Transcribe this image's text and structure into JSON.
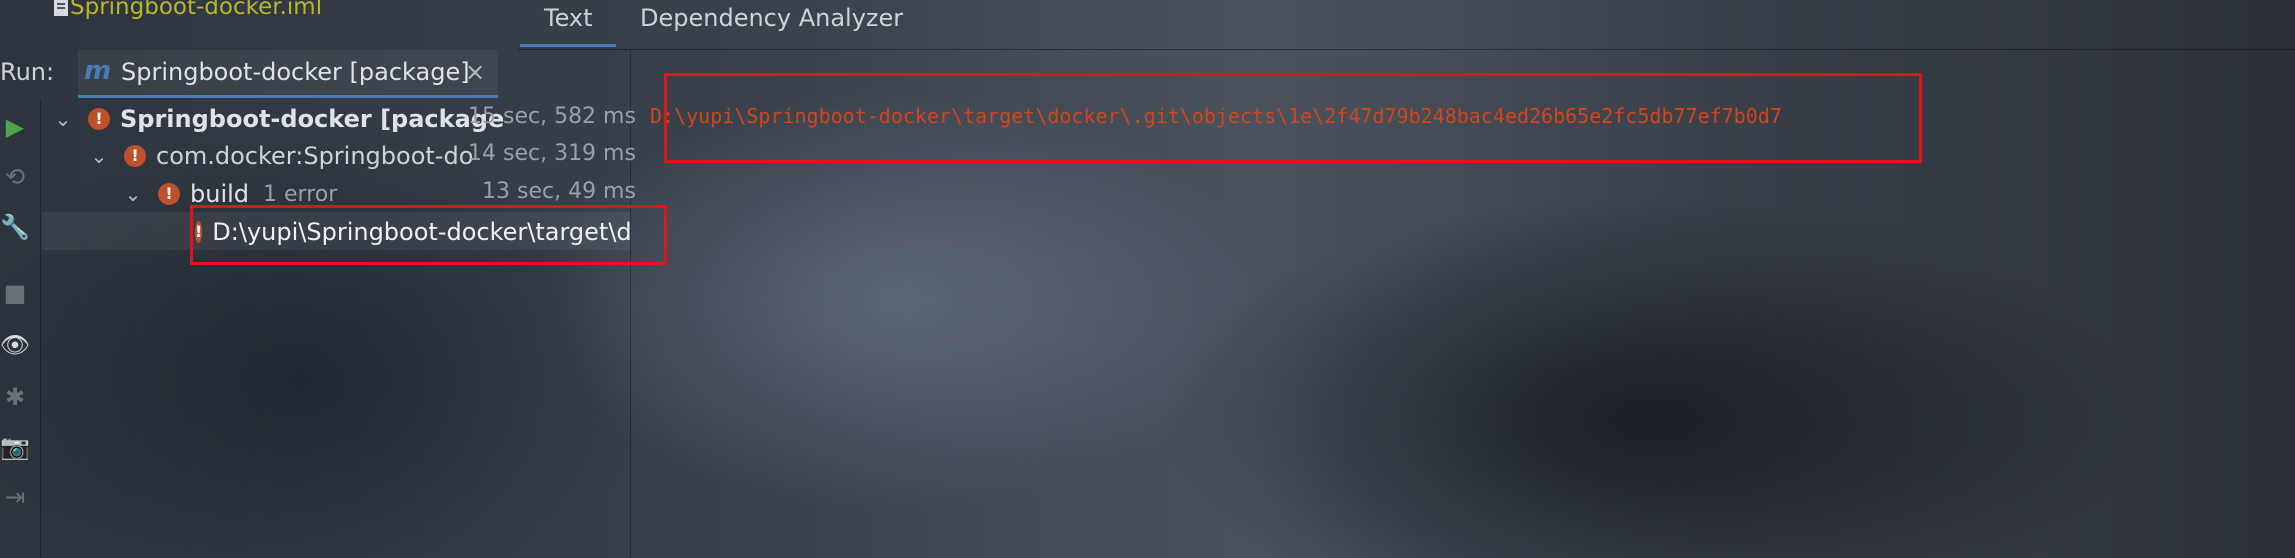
{
  "top": {
    "file_name": "Springboot-docker.iml",
    "tabs": [
      {
        "label": "Text"
      },
      {
        "label": "Dependency Analyzer"
      }
    ]
  },
  "run": {
    "label": "Run:",
    "tab_label": "Springboot-docker [package]",
    "tab_icon": "maven-icon"
  },
  "toolbar": {
    "icons": [
      "rerun-icon",
      "rerun-failed-icon",
      "wrench-icon",
      "stop-icon",
      "eye-icon",
      "debug-icon",
      "camera-icon",
      "exit-icon"
    ]
  },
  "tree": {
    "rows": [
      {
        "label": "Springboot-docker [package",
        "time": "15 sec, 582 ms"
      },
      {
        "label": "com.docker:Springboot-do",
        "time": "14 sec, 319 ms"
      },
      {
        "label": "build",
        "suffix": "1 error",
        "time": "13 sec, 49 ms"
      },
      {
        "label": "D:\\yupi\\Springboot-docker\\target\\d"
      }
    ]
  },
  "output": {
    "text": "D:\\yupi\\Springboot-docker\\target\\docker\\.git\\objects\\1e\\2f47d79b248bac4ed26b65e2fc5db77ef7b0d7"
  },
  "colors": {
    "accent": "#4b7bb6",
    "error": "#c0502c",
    "highlight_box": "#e0141b",
    "output_text": "#d2451d",
    "file_name": "#b9b62a"
  }
}
